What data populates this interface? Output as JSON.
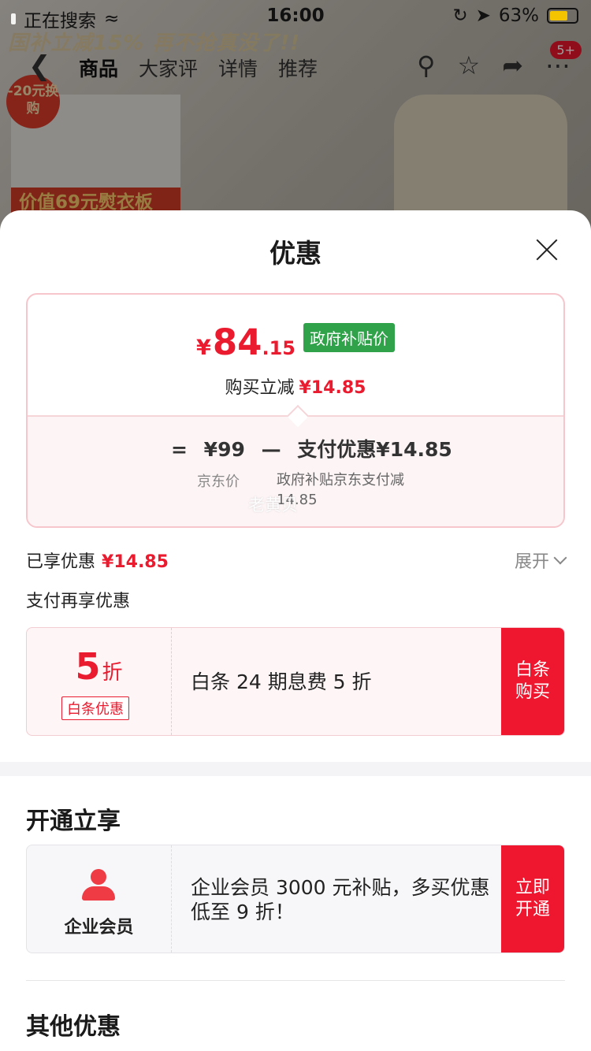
{
  "status_bar": {
    "left_text": "正在搜索",
    "time": "16:00",
    "battery": "63%"
  },
  "background_page": {
    "promo_banner": "国补立减15% 再不抢真没了!!",
    "nav_tabs": [
      "商品",
      "大家评",
      "详情",
      "推荐"
    ],
    "badge": "5+",
    "swap_badge": "-20元换购",
    "board_banner": "价值69元熨衣板"
  },
  "sheet": {
    "title": "优惠",
    "price_card": {
      "currency": "¥",
      "price_int": "84",
      "price_dec": ".15",
      "tag": "政府补贴价",
      "save_label": "购买立减",
      "save_value": "¥14.85",
      "calc": [
        "=",
        "¥99",
        "—",
        "支付优惠¥14.85"
      ],
      "jd_price_label": "京东价",
      "discount_desc": "政府补贴京东支付减",
      "discount_amount": "14.85",
      "watermark": "老黄贝"
    },
    "enjoyed_label": "已享优惠",
    "enjoyed_value": "¥14.85",
    "expand_label": "展开",
    "pay_more_label": "支付再享优惠",
    "baitiao": {
      "discount_num": "5",
      "discount_unit": "折",
      "tag": "白条优惠",
      "desc": "白条 24 期息费 5 折",
      "button": "白条购买"
    },
    "open_section": {
      "title": "开通立享",
      "member_label": "企业会员",
      "desc": "企业会员 3000 元补贴，多买优惠低至 9 折！",
      "button": "立即开通"
    },
    "other_section_title": "其他优惠"
  }
}
